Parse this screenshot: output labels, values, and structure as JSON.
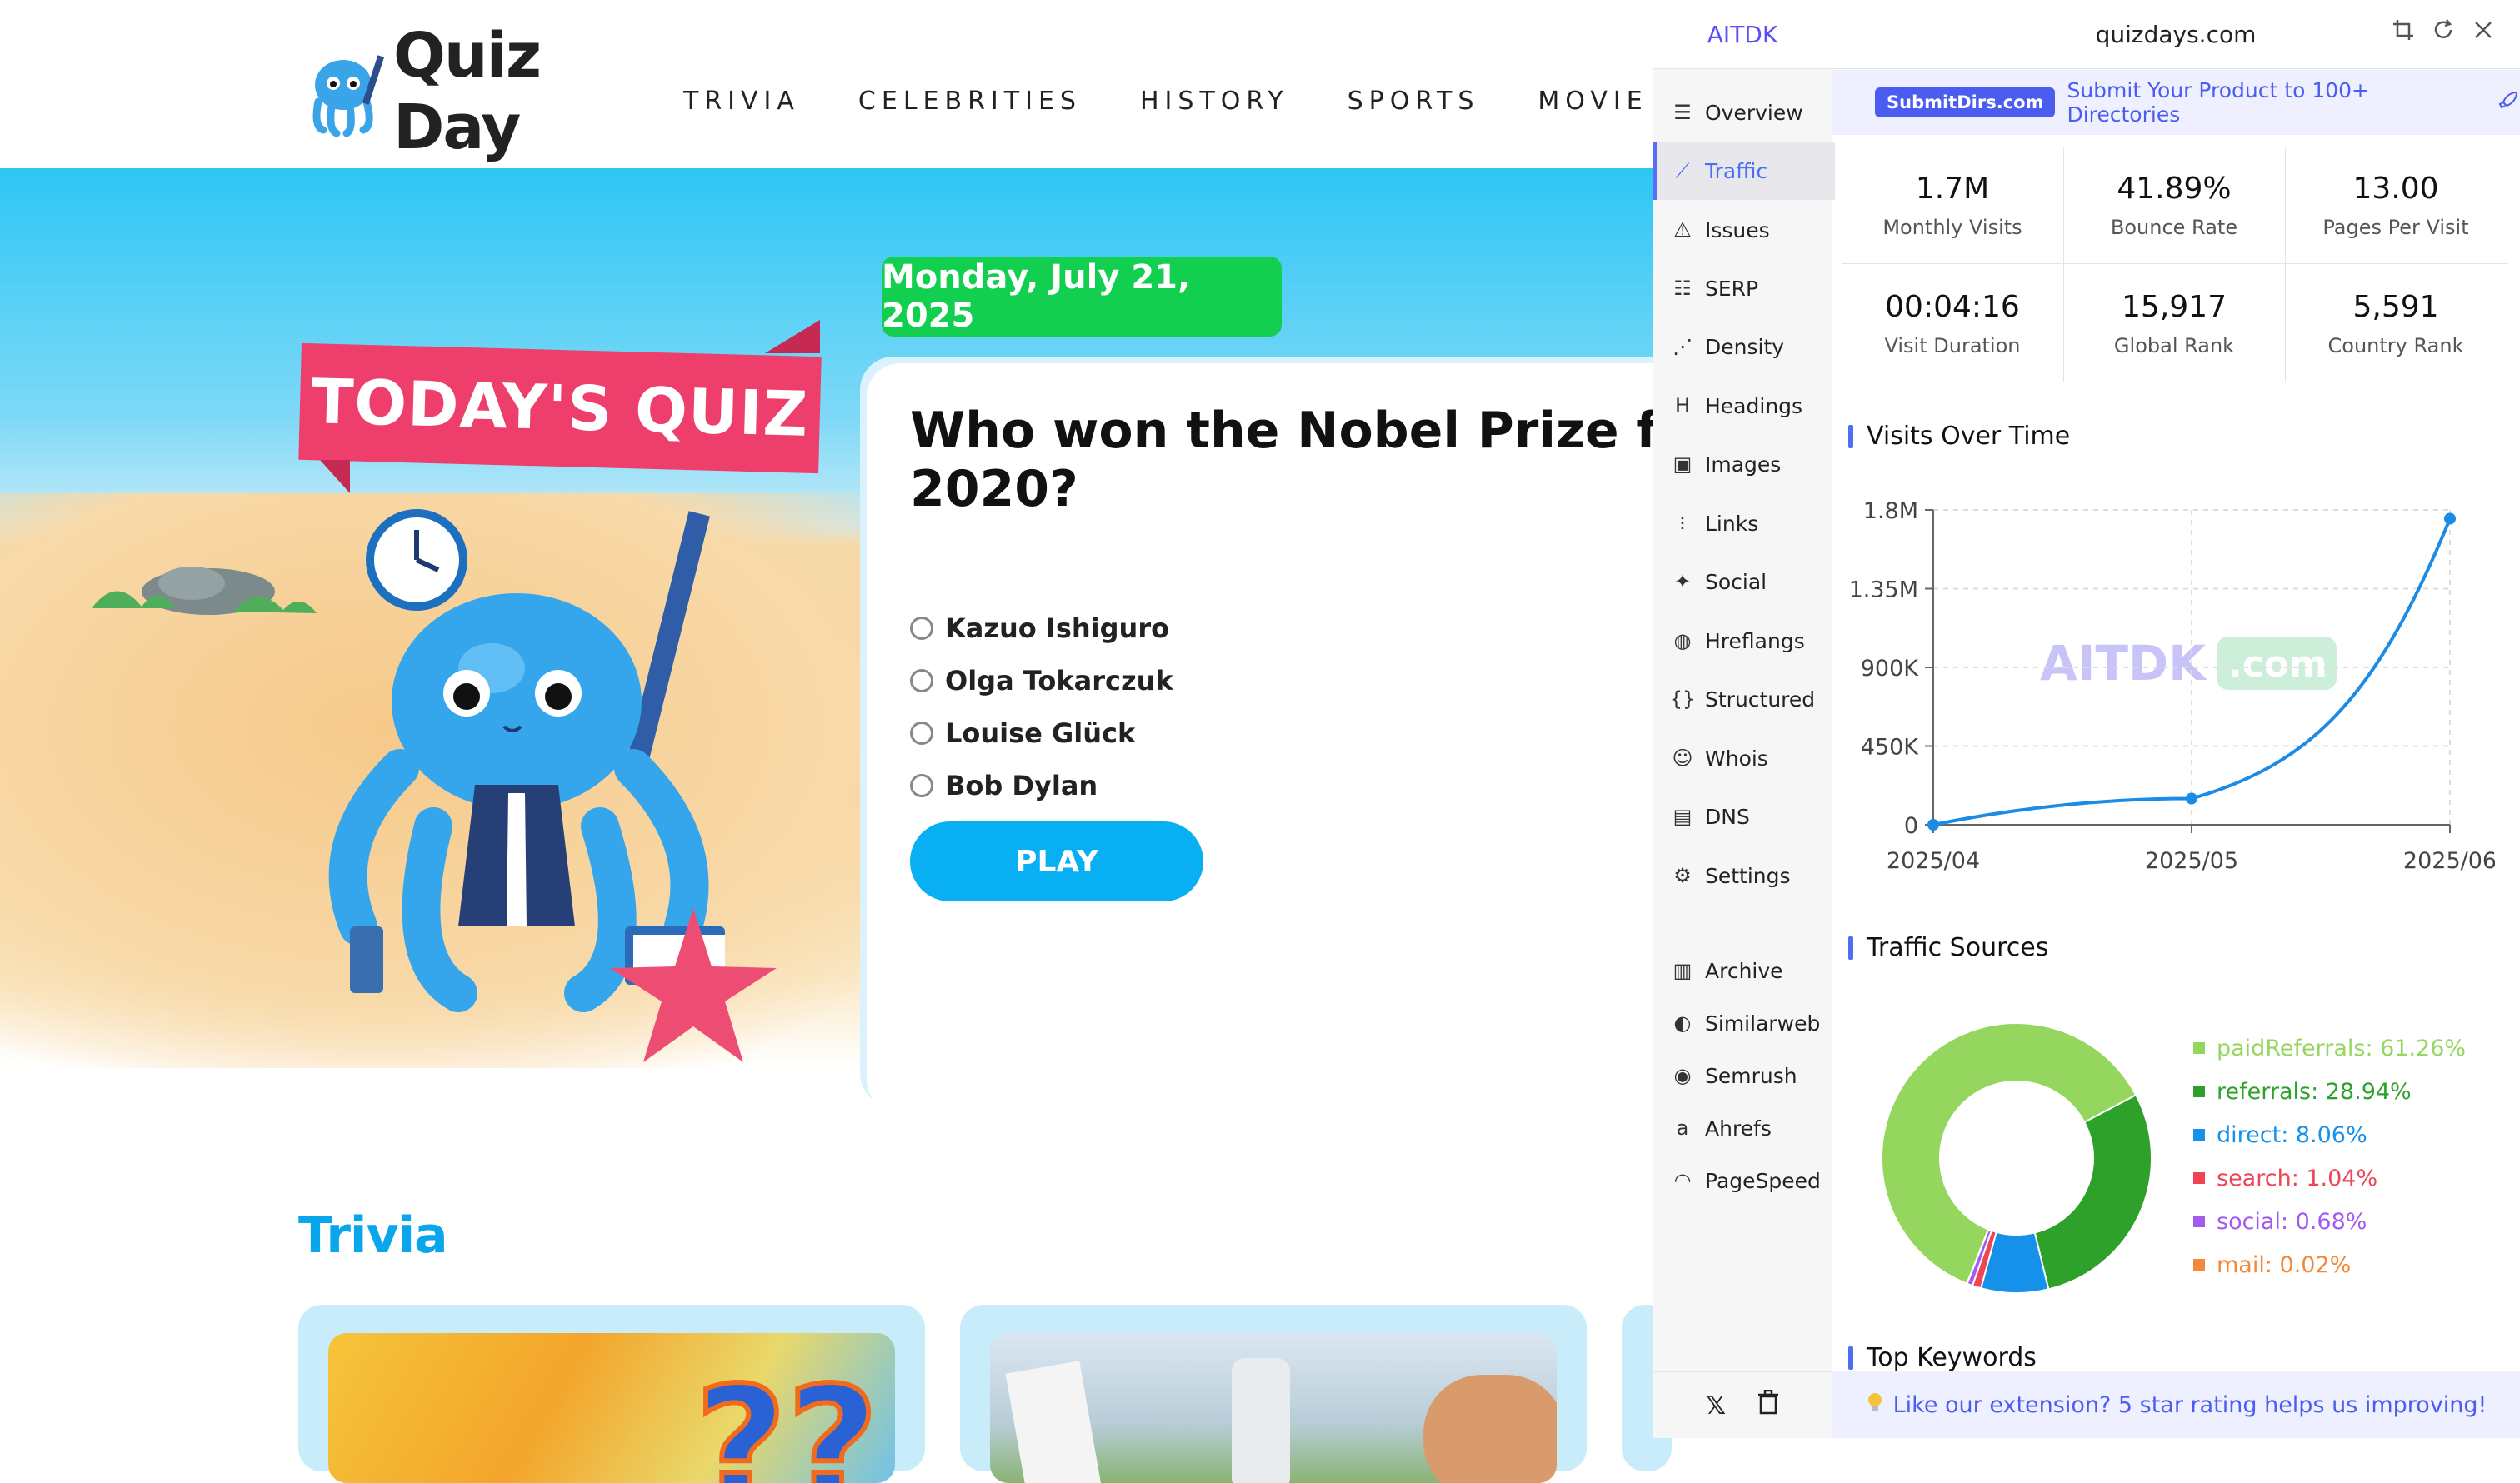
{
  "site": {
    "logo_text": "Quiz Day",
    "nav": [
      "TRIVIA",
      "CELEBRITIES",
      "HISTORY",
      "SPORTS",
      "MOVIE"
    ],
    "date": "Monday, July 21, 2025",
    "ribbon": "TODAY'S QUIZ",
    "question": "Who won the Nobel Prize for L",
    "question_line2": "2020?",
    "options": [
      "Kazuo Ishiguro",
      "Olga Tokarczuk",
      "Louise Glück",
      "Bob Dylan"
    ],
    "play_label": "PLAY",
    "trivia_heading": "Trivia",
    "colors": {
      "accent": "#08aff2",
      "date_pill": "#12cf4f",
      "ribbon": "#ee3e6b"
    }
  },
  "extension": {
    "brand": "AITDK",
    "domain": "quizdays.com",
    "topbar_icons": [
      "crop-icon",
      "refresh-icon",
      "close-icon"
    ],
    "promo": {
      "badge": "SubmitDirs.com",
      "text": "Submit Your Product to 100+ Directories"
    },
    "sidebar": [
      {
        "label": "Overview",
        "icon": "overview-icon",
        "active": false
      },
      {
        "label": "Traffic",
        "icon": "traffic-icon",
        "active": true
      },
      {
        "label": "Issues",
        "icon": "warning-icon",
        "active": false
      },
      {
        "label": "SERP",
        "icon": "serp-icon",
        "active": false
      },
      {
        "label": "Density",
        "icon": "density-icon",
        "active": false
      },
      {
        "label": "Headings",
        "icon": "heading-icon",
        "active": false
      },
      {
        "label": "Images",
        "icon": "image-icon",
        "active": false
      },
      {
        "label": "Links",
        "icon": "links-icon",
        "active": false
      },
      {
        "label": "Social",
        "icon": "social-icon",
        "active": false
      },
      {
        "label": "Hreflangs",
        "icon": "globe-icon",
        "active": false
      },
      {
        "label": "Structured",
        "icon": "braces-icon",
        "active": false
      },
      {
        "label": "Whois",
        "icon": "user-icon",
        "active": false
      },
      {
        "label": "DNS",
        "icon": "server-icon",
        "active": false
      },
      {
        "label": "Settings",
        "icon": "gear-icon",
        "active": false
      }
    ],
    "external": [
      {
        "label": "Archive",
        "icon": "archive-icon"
      },
      {
        "label": "Similarweb",
        "icon": "similarweb-icon"
      },
      {
        "label": "Semrush",
        "icon": "semrush-icon"
      },
      {
        "label": "Ahrefs",
        "icon": "ahrefs-icon"
      },
      {
        "label": "PageSpeed",
        "icon": "pagespeed-icon"
      }
    ],
    "stats": [
      {
        "value": "1.7M",
        "label": "Monthly Visits"
      },
      {
        "value": "41.89%",
        "label": "Bounce Rate"
      },
      {
        "value": "13.00",
        "label": "Pages Per Visit"
      },
      {
        "value": "00:04:16",
        "label": "Visit Duration"
      },
      {
        "value": "15,917",
        "label": "Global Rank"
      },
      {
        "value": "5,591",
        "label": "Country Rank"
      }
    ],
    "visits_title": "Visits Over Time",
    "sources_title": "Traffic Sources",
    "keywords_title": "Top Keywords",
    "watermark": "AITDK",
    "watermark_suffix": ".com",
    "rate_text": "Like our extension? 5 star rating helps us improving!",
    "footer_icons": [
      "x-logo-icon",
      "trash-icon"
    ]
  },
  "chart_data": [
    {
      "type": "line",
      "title": "Visits Over Time",
      "x": [
        "2025/04",
        "2025/05",
        "2025/06"
      ],
      "y_ticks": [
        "0",
        "450K",
        "900K",
        "1.35M",
        "1.8M"
      ],
      "ylim": [
        0,
        1800000
      ],
      "series": [
        {
          "values": [
            0,
            150000,
            1750000
          ],
          "color": "#1a8be6"
        }
      ],
      "grid": true
    },
    {
      "type": "pie",
      "title": "Traffic Sources",
      "donut": true,
      "slices": [
        {
          "name": "paidReferrals",
          "label": "paidReferrals: 61.26%",
          "value": 61.26,
          "color": "#95d75e"
        },
        {
          "name": "referrals",
          "label": "referrals: 28.94%",
          "value": 28.94,
          "color": "#2ea12a"
        },
        {
          "name": "direct",
          "label": "direct: 8.06%",
          "value": 8.06,
          "color": "#1591ea"
        },
        {
          "name": "search",
          "label": "search: 1.04%",
          "value": 1.04,
          "color": "#ee4455"
        },
        {
          "name": "social",
          "label": "social: 0.68%",
          "value": 0.68,
          "color": "#a35af0"
        },
        {
          "name": "mail",
          "label": "mail: 0.02%",
          "value": 0.02,
          "color": "#f2893a"
        }
      ]
    }
  ]
}
